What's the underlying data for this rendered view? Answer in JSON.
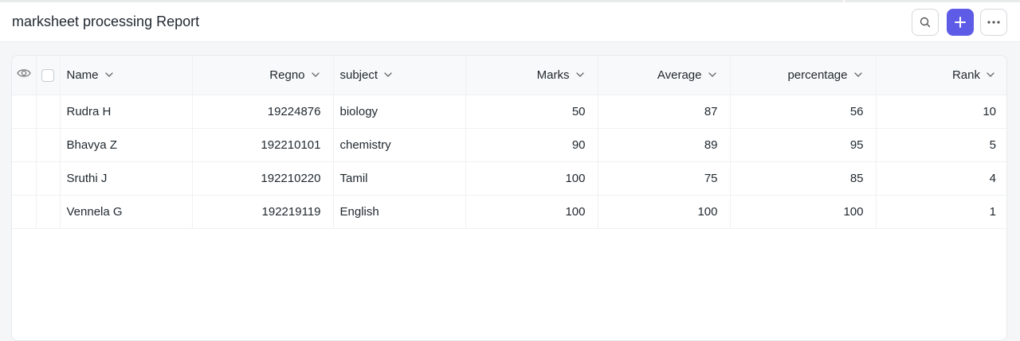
{
  "header": {
    "title": "marksheet processing Report",
    "search_icon": "search-icon",
    "add_icon": "plus-icon",
    "more_icon": "more-horizontal-icon",
    "accent": "#5e5ce6"
  },
  "table": {
    "columns": [
      "Name",
      "Regno",
      "subject",
      "Marks",
      "Average",
      "percentage",
      "Rank"
    ],
    "rows": [
      [
        "Rudra H",
        "19224876",
        "biology",
        "50",
        "87",
        "56",
        "10"
      ],
      [
        "Bhavya Z",
        "192210101",
        "chemistry",
        "90",
        "89",
        "95",
        "5"
      ],
      [
        "Sruthi J",
        "192210220",
        "Tamil",
        "100",
        "75",
        "85",
        "4"
      ],
      [
        "Vennela G",
        "192219119",
        "English",
        "100",
        "100",
        "100",
        "1"
      ]
    ]
  }
}
